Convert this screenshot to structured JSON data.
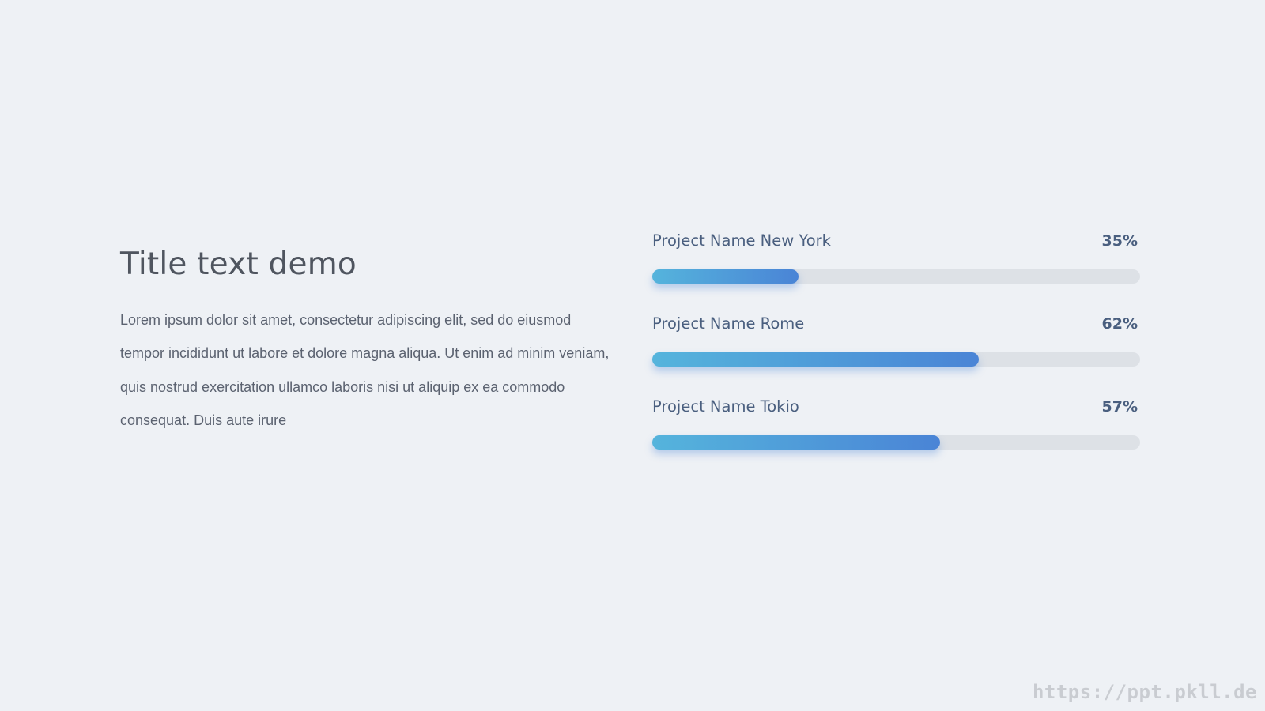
{
  "title": "Title text demo",
  "body": "Lorem ipsum dolor sit amet, consectetur adipiscing elit, sed do eiusmod tempor incididunt ut labore et dolore magna aliqua. Ut enim ad minim veniam, quis nostrud exercitation ullamco laboris nisi ut aliquip ex ea commodo consequat. Duis aute irure",
  "projects": [
    {
      "label": "Project Name New York",
      "value_text": "35%",
      "progress": 30
    },
    {
      "label": "Project Name Rome",
      "value_text": "62%",
      "progress": 67
    },
    {
      "label": "Project Name Tokio",
      "value_text": "57%",
      "progress": 59
    }
  ],
  "colors": {
    "background": "#eef1f5",
    "track": "#dde1e6",
    "fill_start": "#55b4dc",
    "fill_end": "#4a84d6"
  },
  "watermark": "https://ppt.pkll.de"
}
